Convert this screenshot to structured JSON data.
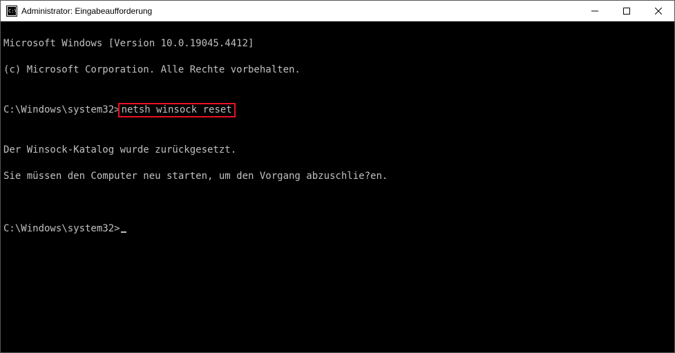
{
  "titlebar": {
    "title": "Administrator: Eingabeaufforderung"
  },
  "terminal": {
    "line1": "Microsoft Windows [Version 10.0.19045.4412]",
    "line2": "(c) Microsoft Corporation. Alle Rechte vorbehalten.",
    "blank1": "",
    "prompt1_prefix": "C:\\Windows\\system32>",
    "prompt1_command": "netsh winsock reset",
    "blank2": "",
    "output1": "Der Winsock-Katalog wurde zurückgesetzt.",
    "output2": "Sie müssen den Computer neu starten, um den Vorgang abzuschlie?en.",
    "blank3": "",
    "blank4": "",
    "prompt2_prefix": "C:\\Windows\\system32>"
  },
  "highlight_color": "#e81123"
}
